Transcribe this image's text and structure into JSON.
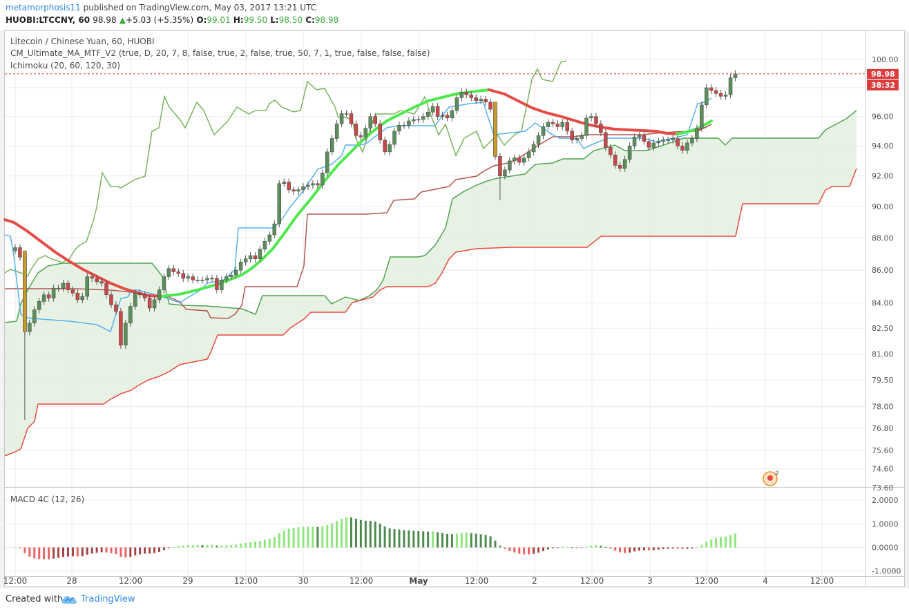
{
  "header": {
    "author": "metamorphosis11",
    "published_text": "published on TradingView.com, May 03, 2017 13:21 UTC",
    "symbol": "HUOBI:LTCCNY, 60",
    "last_price": "98.98",
    "change": "+5.03 (+5.35%)",
    "o_label": "O:",
    "o_value": "99.01",
    "h_label": "H:",
    "h_value": "99.50",
    "l_label": "L:",
    "l_value": "98.50",
    "c_label": "C:",
    "c_value": "98.98"
  },
  "legend": {
    "title": "Litecoin / Chinese Yuan, 60, HUOBI",
    "ma_indicator": "CM_Ultimate_MA_MTF_V2 (true, D, 20, 7, 8, false, true, 2, false, true, 50, 7, 1, true, false, false, false)",
    "ichimoku": "Ichimoku (20, 60, 120, 30)",
    "macd": "MACD 4C (12, 26)"
  },
  "price_tags": {
    "last": "98.98",
    "countdown": "38:32"
  },
  "footer": {
    "created_with": "Created with",
    "brand": "TradingView"
  },
  "colors": {
    "up_candle": "#5b8e5b",
    "down_candle": "#c94848",
    "tenkan": "#55b1ea",
    "kijun": "#b0574f",
    "span_a": "#4fa34f",
    "span_b": "#e8493e",
    "chikou": "#79b35f",
    "cloud": "#e4f1e1",
    "ma_green": "#4ee84e",
    "ma_red": "#e64c46",
    "macd_up_bright": "#8ee67c",
    "macd_up_dark": "#4e8a4e",
    "macd_down_bright": "#ea6262",
    "macd_down_dark": "#a34545",
    "price_tag": "#dd3c3c",
    "link": "#2e8ae6"
  },
  "chart_data": {
    "type": "candlestick",
    "x_tick_labels": [
      "12:00",
      "28",
      "12:00",
      "29",
      "12:00",
      "30",
      "12:00",
      "May",
      "12:00",
      "2",
      "12:00",
      "3",
      "12:00",
      "4",
      "12:00"
    ],
    "y_axis_labels": [
      "100.00",
      "98.00",
      "96.00",
      "94.00",
      "92.00",
      "90.00",
      "88.00",
      "86.00",
      "84.00",
      "82.50",
      "81.00",
      "79.50",
      "78.00",
      "76.80",
      "75.60",
      "74.60",
      "73.60"
    ],
    "y_scale": "log",
    "ylim": [
      73.6,
      100.8
    ],
    "bars": 149,
    "closes": [
      87.4,
      86.8,
      82.3,
      82.8,
      83.6,
      84.1,
      84.5,
      84.3,
      84.9,
      84.9,
      85.2,
      84.8,
      84.6,
      84.2,
      84.4,
      85.6,
      85.5,
      85.3,
      85.2,
      84.5,
      83.9,
      83.5,
      81.5,
      82.8,
      83.8,
      84.6,
      84.5,
      84.3,
      83.7,
      84.2,
      84.8,
      85.6,
      86.1,
      85.9,
      85.8,
      85.5,
      85.6,
      85.4,
      85.4,
      85.4,
      85.5,
      85.5,
      84.8,
      85.4,
      85.6,
      85.7,
      86.0,
      86.5,
      86.7,
      86.9,
      86.7,
      87.3,
      87.8,
      88.2,
      88.9,
      91.5,
      91.6,
      91.1,
      91.0,
      91.1,
      91.3,
      91.4,
      91.5,
      91.4,
      92.2,
      93.6,
      94.5,
      95.5,
      96.2,
      96.2,
      95.5,
      94.7,
      94.6,
      95.2,
      96.0,
      95.5,
      94.4,
      93.6,
      94.1,
      95.0,
      95.4,
      95.4,
      95.7,
      95.8,
      95.8,
      96.0,
      96.3,
      96.7,
      96.0,
      96.1,
      95.9,
      96.4,
      97.3,
      97.7,
      97.5,
      97.3,
      97.1,
      97.2,
      97.0,
      96.5,
      93.3,
      92.0,
      92.4,
      93.0,
      93.2,
      92.9,
      93.2,
      93.6,
      94.1,
      94.7,
      95.3,
      95.6,
      95.5,
      95.3,
      95.6,
      95.0,
      94.4,
      94.5,
      94.7,
      95.9,
      96.0,
      95.5,
      94.9,
      93.9,
      93.4,
      92.7,
      92.5,
      93.1,
      94.0,
      94.6,
      94.7,
      94.3,
      93.9,
      94.2,
      94.3,
      94.4,
      94.4,
      94.5,
      94.0,
      93.7,
      94.2,
      94.5,
      95.2,
      96.8,
      98.0,
      97.8,
      97.6,
      97.4,
      97.5,
      98.7,
      98.98
    ]
  }
}
